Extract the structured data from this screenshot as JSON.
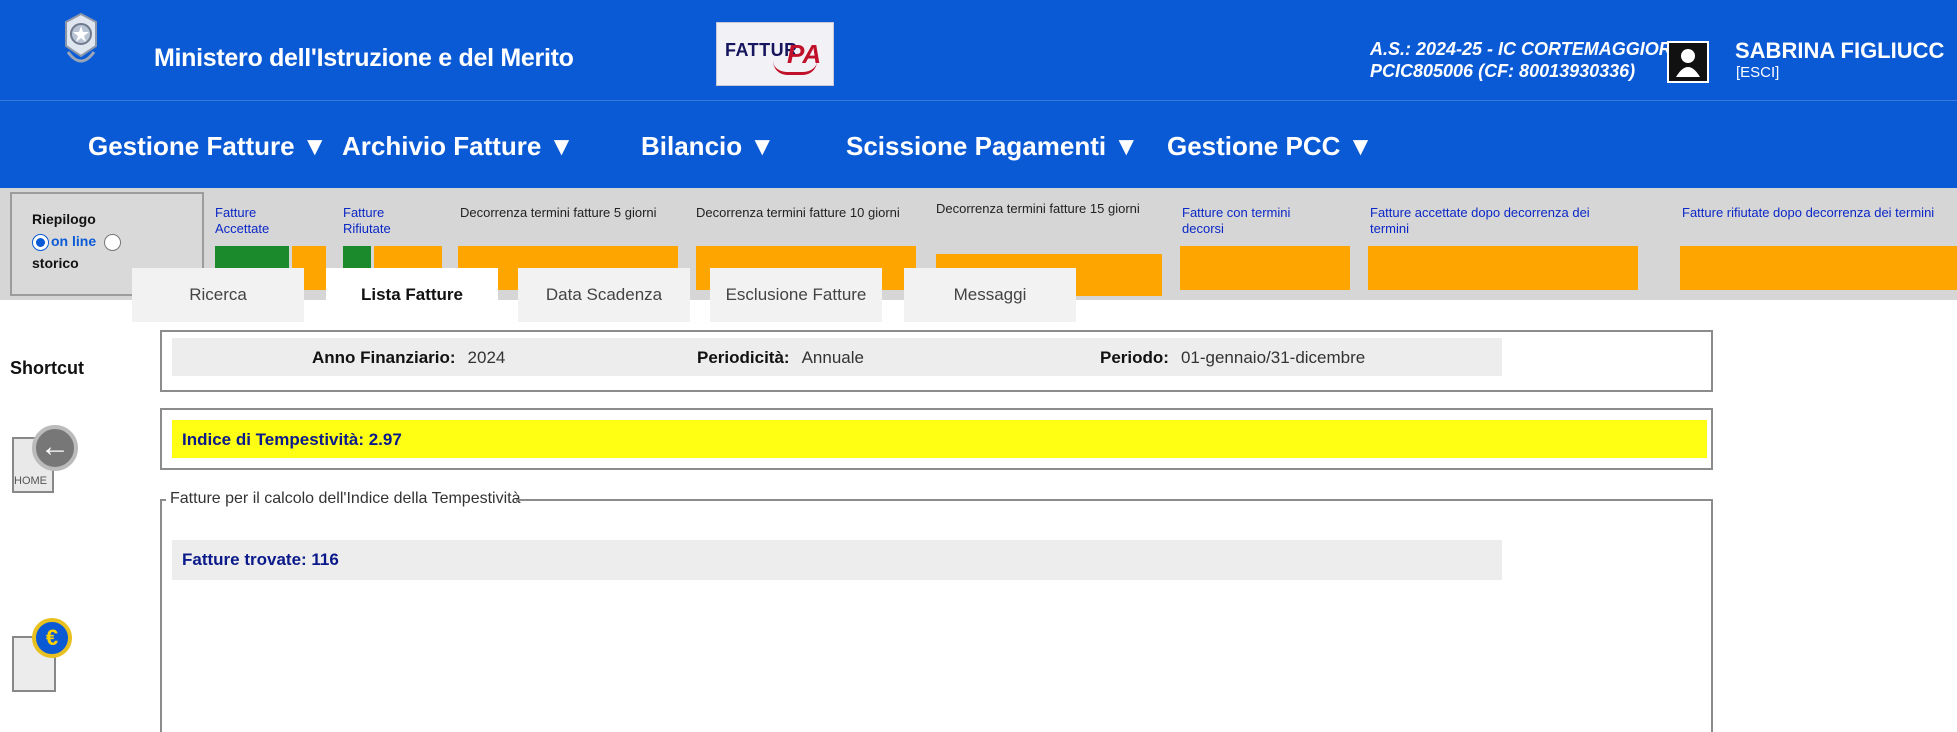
{
  "header": {
    "ministry": "Ministero dell'Istruzione e del Merito",
    "logo_text": "FATTUR",
    "logo_pa": "PA",
    "school_line1": "A.S.: 2024-25  - IC CORTEMAGGIORE",
    "school_line2": "PCIC805006  (CF: 80013930336)",
    "user_name": "SABRINA FIGLIUCC",
    "user_exit": "[ESCI]"
  },
  "menu": [
    {
      "label": "Gestione Fatture ▼"
    },
    {
      "label": "Archivio Fatture ▼"
    },
    {
      "label": "Bilancio ▼"
    },
    {
      "label": "Scissione Pagamenti ▼"
    },
    {
      "label": "Gestione PCC ▼"
    }
  ],
  "summary": {
    "riepilogo": "Riepilogo",
    "online": "on line",
    "storico": "storico",
    "stats": [
      {
        "label": "Fatture Accettate"
      },
      {
        "label": "Fatture Rifiutate"
      },
      {
        "label": "Decorrenza termini fatture 5 giorni"
      },
      {
        "label": "Decorrenza termini fatture 10 giorni"
      },
      {
        "label": "Decorrenza termini fatture 15 giorni"
      },
      {
        "label": "Fatture con termini decorsi"
      },
      {
        "label": "Fatture accettate dopo decorrenza dei termini"
      },
      {
        "label": "Fatture rifiutate dopo decorrenza dei termini"
      }
    ],
    "colors": {
      "green": "#1b8a2c",
      "orange": "#ffa500"
    }
  },
  "shortcut": {
    "title": "Shortcut",
    "home_label": "HOME",
    "home_icon": "home-back-icon",
    "euro_icon": "euro-document-icon"
  },
  "tabs": [
    {
      "label": "Ricerca"
    },
    {
      "label": "Lista Fatture"
    },
    {
      "label": "Data Scadenza"
    },
    {
      "label": "Esclusione Fatture"
    },
    {
      "label": "Messaggi"
    }
  ],
  "periodo": {
    "anno_label": "Anno Finanziario:",
    "anno_value": "2024",
    "periodicita_label": "Periodicità:",
    "periodicita_value": "Annuale",
    "periodo_label": "Periodo:",
    "periodo_value": "01-gennaio/31-dicembre"
  },
  "indice": {
    "text": "Indice di Tempestività: 2.97"
  },
  "fatture": {
    "legend": "Fatture per il calcolo dell'Indice della Tempestività",
    "trovate": "Fatture trovate: 116"
  }
}
